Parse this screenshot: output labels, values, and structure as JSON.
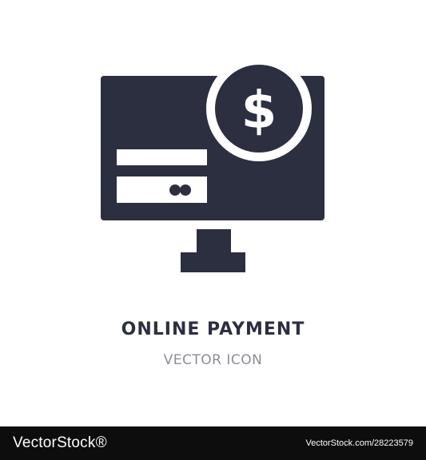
{
  "icon": {
    "name": "online-payment-icon",
    "color": "#2b2f40",
    "background": "#ffffff",
    "symbol": "$"
  },
  "caption": {
    "title": "ONLINE PAYMENT",
    "subtitle": "VECTOR ICON"
  },
  "footer": {
    "logo": "VectorStock®",
    "url": "VectorStock.com/28223579",
    "background": "#0d0d0d"
  }
}
